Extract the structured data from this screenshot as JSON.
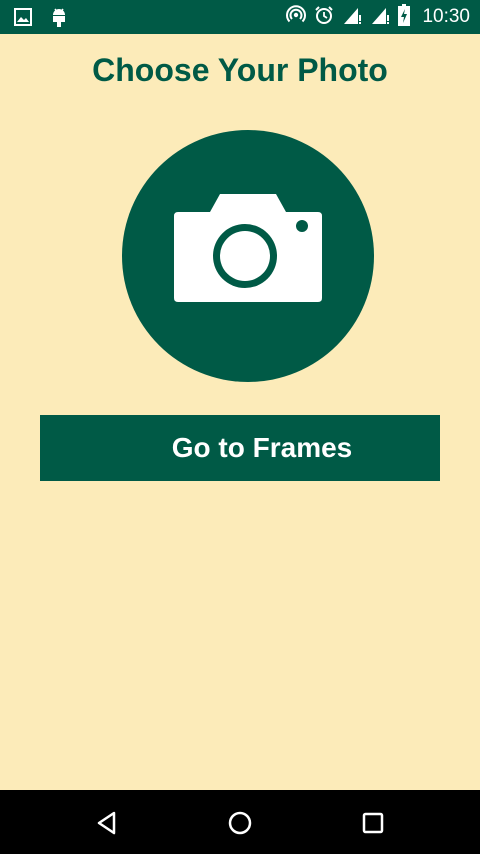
{
  "status_bar": {
    "time": "10:30",
    "icons_left": [
      "image-icon",
      "android-icon"
    ],
    "icons_right": [
      "hotspot-icon",
      "alarm-icon",
      "signal-icon",
      "signal-icon",
      "battery-icon"
    ]
  },
  "main": {
    "title": "Choose Your Photo",
    "photo_picker_icon": "camera-icon",
    "frames_button_label": "Go to Frames"
  },
  "nav_bar": {
    "buttons": [
      "back",
      "home",
      "recents"
    ]
  },
  "colors": {
    "background": "#FCEBB9",
    "accent": "#005A46",
    "text_on_accent": "#FFFFFF"
  }
}
